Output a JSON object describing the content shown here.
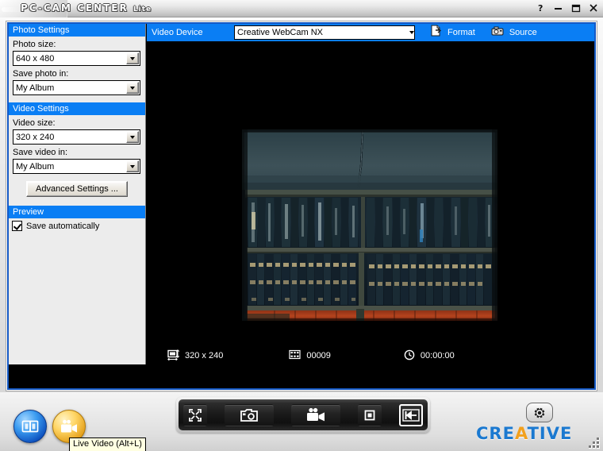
{
  "window": {
    "title_main": "PC-CAM CENTER",
    "title_suffix": "Lite",
    "buttons": {
      "help": "?",
      "minimize": "–",
      "maximize": "❐",
      "close": "✕"
    }
  },
  "sidebar": {
    "photo_settings": {
      "header": "Photo Settings",
      "photo_size_label": "Photo size:",
      "photo_size_value": "640 x 480",
      "save_photo_label": "Save photo in:",
      "save_photo_value": "My Album"
    },
    "video_settings": {
      "header": "Video Settings",
      "video_size_label": "Video size:",
      "video_size_value": "320 x 240",
      "save_video_label": "Save video in:",
      "save_video_value": "My Album",
      "advanced_button": "Advanced Settings ..."
    },
    "preview": {
      "header": "Preview",
      "save_automatically_label": "Save automatically",
      "save_automatically_checked": true
    }
  },
  "video_toolbar": {
    "device_label": "Video Device",
    "device_value": "Creative WebCam NX",
    "format_label": "Format",
    "source_label": "Source"
  },
  "status_bar": {
    "resolution": "320 x 240",
    "frame_count": "00009",
    "elapsed_time": "00:00:00"
  },
  "bottom": {
    "album_button_name": "Album",
    "live_video_button_name": "Live Video",
    "tooltip": "Live Video (Alt+L)",
    "dock": {
      "fullscreen": "Full Screen",
      "snapshot": "Take Photo",
      "record": "Record Video",
      "stop": "Stop",
      "back": "Back"
    },
    "settings_button_name": "Settings",
    "logo_pre": "CRE",
    "logo_accent": "A",
    "logo_post": "TIVE"
  },
  "colors": {
    "accent_blue": "#0a7ef4",
    "frame_blue": "#1559c4",
    "panel_gray": "#ececec",
    "logo_blue": "#1b79d0",
    "logo_amber": "#f3a01c",
    "tooltip_bg": "#ffffe1"
  }
}
